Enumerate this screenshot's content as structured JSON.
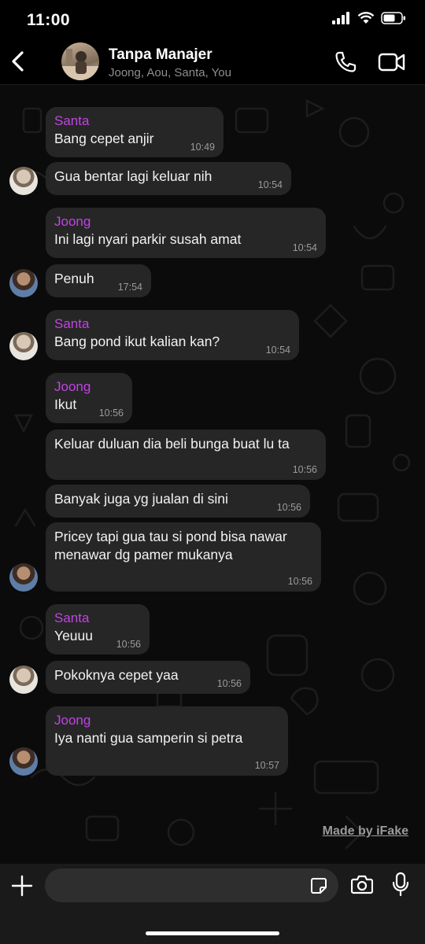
{
  "status_bar": {
    "time": "11:00"
  },
  "header": {
    "title": "Tanpa Manajer",
    "subtitle": "Joong, Aou, Santa, You"
  },
  "messages": [
    {
      "sender": "Santa",
      "text": "Bang cepet anjir",
      "time": "10:49"
    },
    {
      "sender": "",
      "text": "Gua bentar lagi keluar nih",
      "time": "10:54"
    },
    {
      "sender": "Joong",
      "text": "Ini lagi nyari parkir susah amat",
      "time": "10:54"
    },
    {
      "sender": "",
      "text": "Penuh",
      "time": "17:54"
    },
    {
      "sender": "Santa",
      "text": "Bang pond ikut kalian kan?",
      "time": "10:54"
    },
    {
      "sender": "Joong",
      "text": "Ikut",
      "time": "10:56"
    },
    {
      "sender": "",
      "text": "Keluar duluan dia beli bunga buat lu ta",
      "time": "10:56"
    },
    {
      "sender": "",
      "text": "Banyak juga yg jualan di sini",
      "time": "10:56"
    },
    {
      "sender": "",
      "text": "Pricey tapi gua tau si pond bisa nawar menawar dg pamer mukanya",
      "time": "10:56"
    },
    {
      "sender": "Santa",
      "text": "Yeuuu",
      "time": "10:56"
    },
    {
      "sender": "",
      "text": "Pokoknya cepet yaa",
      "time": "10:56"
    },
    {
      "sender": "Joong",
      "text": "Iya nanti gua samperin si petra",
      "time": "10:57"
    }
  ],
  "watermark": "Made by iFake",
  "colors": {
    "sender_name": "#c243e6",
    "bubble": "#262626",
    "background": "#000000"
  },
  "icons": [
    "back-arrow-icon",
    "phone-icon",
    "video-camera-icon",
    "plus-icon",
    "sticker-icon",
    "camera-icon",
    "microphone-icon"
  ]
}
